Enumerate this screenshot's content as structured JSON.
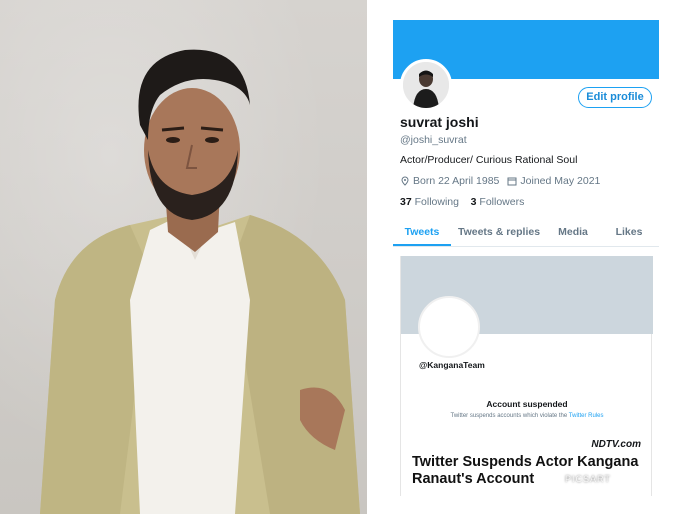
{
  "profile": {
    "name": "suvrat joshi",
    "handle": "@joshi_suvrat",
    "bio": "Actor/Producer/ Curious Rational Soul",
    "born": "Born 22 April 1985",
    "joined": "Joined May 2021",
    "following_count": "37",
    "following_label": "Following",
    "followers_count": "3",
    "followers_label": "Followers",
    "edit_button": "Edit profile"
  },
  "tabs": [
    {
      "label": "Tweets"
    },
    {
      "label": "Tweets & replies"
    },
    {
      "label": "Media"
    },
    {
      "label": "Likes"
    }
  ],
  "card": {
    "handle": "@KanganaTeam",
    "status_title": "Account suspended",
    "status_text": "Twitter suspends accounts which violate the",
    "status_link": "Twitter Rules",
    "source": "NDTV.com",
    "headline": "Twitter Suspends Actor Kangana Ranaut's Account"
  },
  "watermark": "PICSART",
  "colors": {
    "twitter_blue": "#1da1f2",
    "banner_gray": "#ccd6dd"
  },
  "icons": [
    "location-icon",
    "calendar-icon"
  ]
}
